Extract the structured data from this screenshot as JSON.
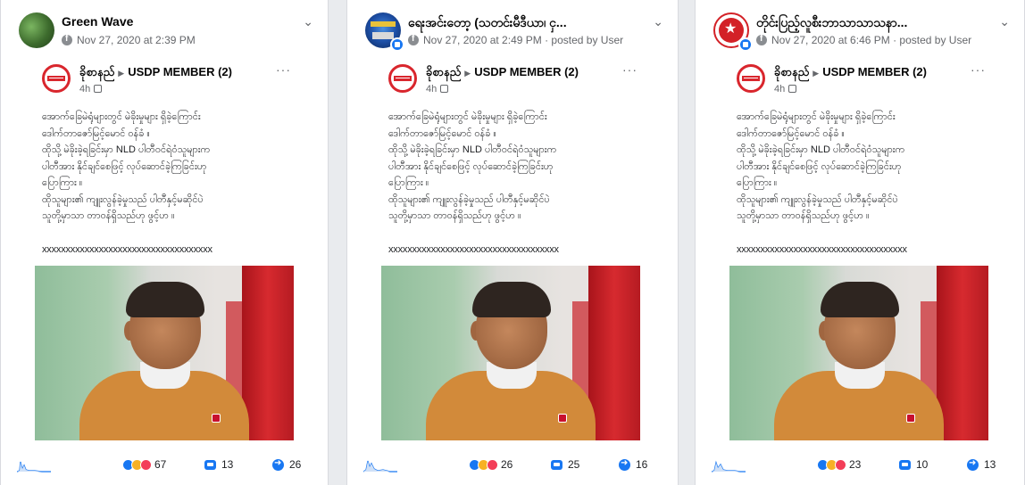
{
  "posts": [
    {
      "name": "Green Wave",
      "meta": "Nov 27, 2020 at 2:39 PM",
      "avatar": "green-wave-avatar",
      "reactions": "67",
      "comments": "13",
      "shares": "26"
    },
    {
      "name": "ရေးအင်းတော့ (သတင်းမီဒီယာ၊ ငှ...",
      "meta": "Nov 27, 2020 at 2:49 PM · posted by User",
      "avatar": "news-media-avatar",
      "reactions": "26",
      "comments": "25",
      "shares": "16"
    },
    {
      "name": "တိုင်းပြည့်လူစီးဘာသာသာသနာ...",
      "meta": "Nov 27, 2020 at 6:46 PM · posted by User",
      "avatar": "party-logo-avatar",
      "reactions": "23",
      "comments": "10",
      "shares": "13"
    }
  ],
  "embedded": {
    "author": "ခိုစာနည်",
    "group": "USDP MEMBER (2)",
    "time": "4h",
    "lines": [
      "အောက်ခြေမဲရုံများတွင် မဲခိုးမှုများ ရှိခဲ့ကြောင်း",
      "ဒေါက်တာဇော်မြင့်မောင် ဝန်ခံ ။",
      "ထိုသို့ မဲခိုးခဲ့ရခြင်းမှာ NLD ပါတီဝင်ရဲဝံသူများက",
      "ပါတီအား နိုင်ချင်စေဖြင့် လုပ်ဆောင်ခဲ့ကြခြင်းဟု",
      "ပြောကြား ။",
      "ထိုသူများ၏ ကျူးလွန်ခဲ့မှုသည် ပါတီနှင့်မဆိုင်ပဲ",
      "သူတို့မှာသာ တာဝန်ရှိသည်ဟု ဖွင့်ဟ ။"
    ],
    "separator": "xxxxxxxxxxxxxxxxxxxxxxxxxxxxxxxxxxxx"
  }
}
